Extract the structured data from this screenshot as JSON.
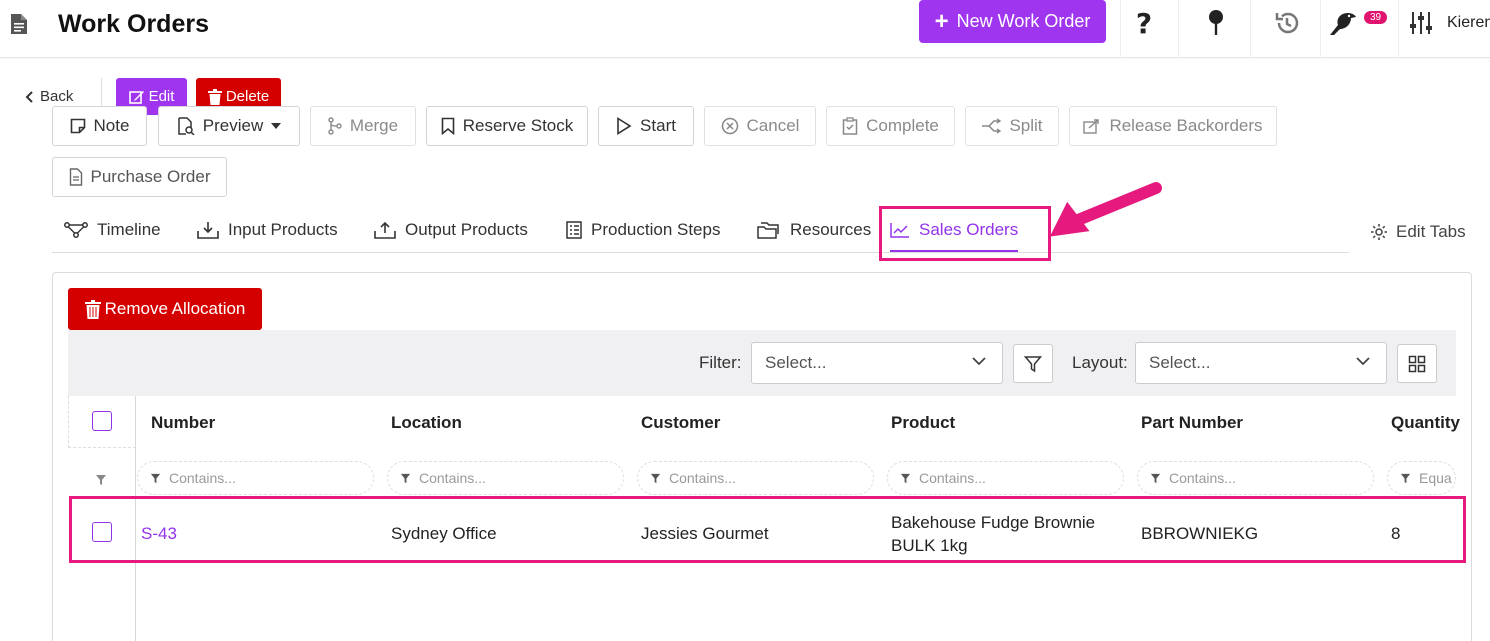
{
  "header": {
    "title": "Work Orders",
    "new_button": "New Work Order",
    "notification_count": "39",
    "user": "Kieren"
  },
  "actions": {
    "back": "Back",
    "edit": "Edit",
    "delete": "Delete"
  },
  "toolbar": {
    "note": "Note",
    "preview": "Preview",
    "merge": "Merge",
    "reserve_stock": "Reserve Stock",
    "start": "Start",
    "cancel": "Cancel",
    "complete": "Complete",
    "split": "Split",
    "release_backorders": "Release Backorders",
    "purchase_order": "Purchase Order"
  },
  "tabs": {
    "timeline": "Timeline",
    "input_products": "Input Products",
    "output_products": "Output Products",
    "production_steps": "Production Steps",
    "resources": "Resources",
    "sales_orders": "Sales Orders",
    "edit_tabs": "Edit Tabs",
    "active": "sales_orders"
  },
  "panel": {
    "remove_allocation": "Remove Allocation",
    "filter_label": "Filter:",
    "filter_placeholder": "Select...",
    "layout_label": "Layout:",
    "layout_placeholder": "Select..."
  },
  "grid": {
    "columns": [
      "Number",
      "Location",
      "Customer",
      "Product",
      "Part Number",
      "Quantity"
    ],
    "filter_placeholders": [
      "Contains...",
      "Contains...",
      "Contains...",
      "Contains...",
      "Contains...",
      "Equa"
    ],
    "rows": [
      {
        "number": "S-43",
        "location": "Sydney Office",
        "customer": "Jessies Gourmet",
        "product_line1": "Bakehouse Fudge Brownie",
        "product_line2": "BULK 1kg",
        "part_number": "BBROWNIEKG",
        "quantity": "8"
      }
    ]
  },
  "colors": {
    "accent_purple": "#a035f0",
    "danger_red": "#d40000",
    "highlight_pink": "#e6197e"
  }
}
